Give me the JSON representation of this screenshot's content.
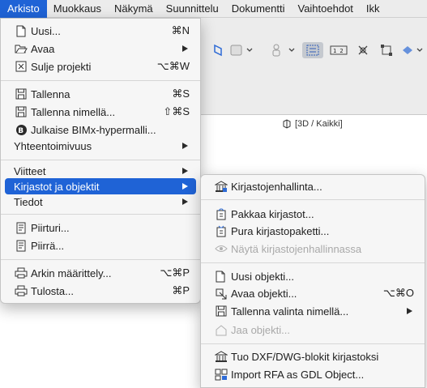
{
  "menubar": {
    "items": [
      "Arkisto",
      "Muokkaus",
      "Näkymä",
      "Suunnittelu",
      "Dokumentti",
      "Vaihtoehdot",
      "Ikk"
    ],
    "active_index": 0
  },
  "view": {
    "title": "[3D / Kaikki]"
  },
  "main_menu": {
    "items": [
      {
        "label": "Uusi...",
        "shortcut": "⌘N",
        "icon": "new-document-icon"
      },
      {
        "label": "Avaa",
        "submenu": true,
        "icon": "open-folder-icon"
      },
      {
        "label": "Sulje projekti",
        "shortcut": "⌥⌘W",
        "icon": "close-project-icon"
      },
      {
        "label": "Tallenna",
        "shortcut": "⌘S",
        "icon": "save-icon"
      },
      {
        "label": "Tallenna nimellä...",
        "shortcut": "⇧⌘S",
        "icon": "save-as-icon"
      },
      {
        "label": "Julkaise BIMx-hypermalli...",
        "icon": "bimx-icon"
      },
      {
        "label": "Yhteentoimivuus",
        "submenu": true
      },
      {
        "label": "Viitteet",
        "submenu": true
      },
      {
        "label": "Kirjastot ja objektit",
        "submenu": true,
        "highlighted": true
      },
      {
        "label": "Tiedot",
        "submenu": true
      },
      {
        "label": "Piirturi...",
        "icon": "plotter-icon"
      },
      {
        "label": "Piirrä...",
        "icon": "plot-icon"
      },
      {
        "label": "Arkin määrittely...",
        "shortcut": "⌥⌘P",
        "icon": "page-setup-icon"
      },
      {
        "label": "Tulosta...",
        "shortcut": "⌘P",
        "icon": "print-icon"
      }
    ]
  },
  "sub_menu": {
    "items": [
      {
        "label": "Kirjastojenhallinta...",
        "icon": "library-manager-icon"
      },
      {
        "label": "Pakkaa kirjastot...",
        "icon": "pack-library-icon"
      },
      {
        "label": "Pura kirjastopaketti...",
        "icon": "unpack-library-icon"
      },
      {
        "label": "Näytä kirjastojenhallinnassa",
        "disabled": true,
        "icon": "show-in-library-icon"
      },
      {
        "label": "Uusi objekti...",
        "icon": "new-object-icon"
      },
      {
        "label": "Avaa objekti...",
        "shortcut": "⌥⌘O",
        "icon": "open-object-icon"
      },
      {
        "label": "Tallenna valinta nimellä...",
        "submenu": true,
        "icon": "save-selection-icon"
      },
      {
        "label": "Jaa objekti...",
        "disabled": true,
        "icon": "share-object-icon"
      },
      {
        "label": "Tuo DXF/DWG-blokit kirjastoksi",
        "icon": "import-dxf-icon"
      },
      {
        "label": "Import RFA as GDL Object...",
        "icon": "import-rfa-icon"
      }
    ]
  },
  "colors": {
    "highlight": "#1f63d6",
    "menu_bg": "#f6f6f6",
    "menubar_bg": "#ececec"
  }
}
